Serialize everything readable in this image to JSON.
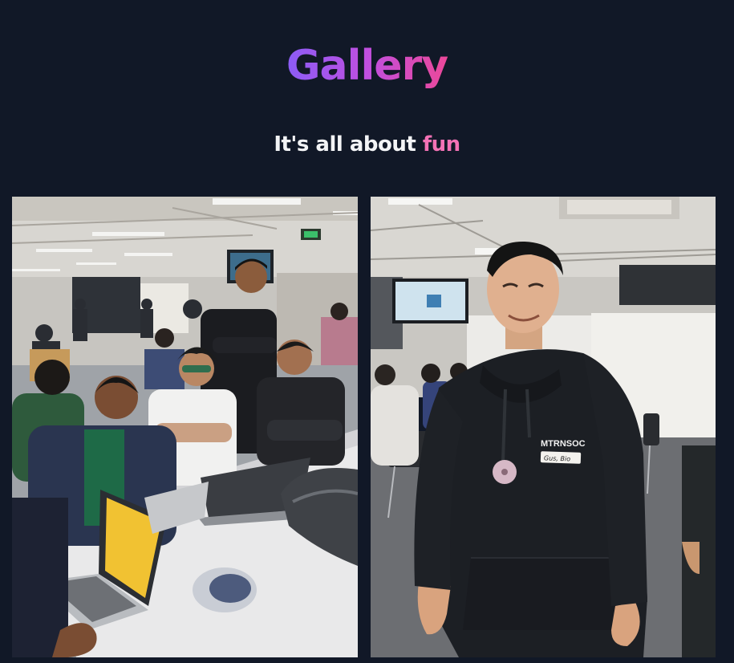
{
  "header": {
    "title": "Gallery",
    "subtitle_prefix": "It's all about ",
    "subtitle_accent": "fun"
  },
  "colors": {
    "background": "#111827",
    "title_gradient_start": "#8b5cf6",
    "title_gradient_end": "#ec4899",
    "accent": "#f472b6",
    "subtitle_text": "#f3f4f6"
  },
  "gallery": {
    "photos": [
      {
        "subject": "students working on laptops in a classroom"
      },
      {
        "subject": "smiling student in black hoodie with MTRNSOC name tag"
      }
    ],
    "hoodie_logo": "MTRNSOC",
    "name_tag": "Gus, Bio"
  }
}
